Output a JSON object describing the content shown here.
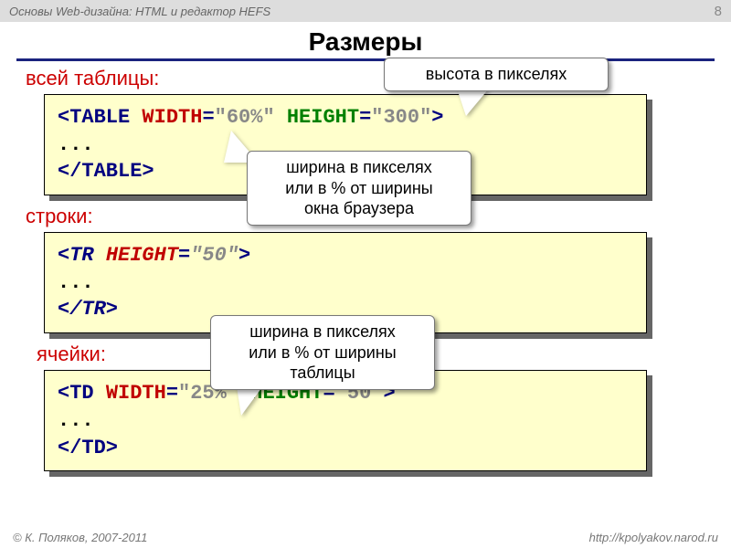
{
  "header": {
    "course": "Основы Web-дизайна: HTML и редактор HEFS",
    "page": "8"
  },
  "title": "Размеры",
  "labels": {
    "table": "всей таблицы:",
    "row": "строки:",
    "cell": "ячейки:"
  },
  "code": {
    "table": {
      "open_pre": "<TABLE ",
      "w": "WIDTH",
      "eq": "=",
      "wval": "\"60%\"",
      "sp": " ",
      "h": "HEIGHT",
      "hval": "\"300\"",
      "open_post": ">",
      "dots": "...",
      "close": "</TABLE>"
    },
    "row": {
      "open_pre": "<TR ",
      "h": "HEIGHT",
      "eq": "=",
      "hval": "\"50\"",
      "open_post": ">",
      "dots": "...",
      "close": "</TR>"
    },
    "cell": {
      "open_pre": "<TD ",
      "w": "WIDTH",
      "eq": "=",
      "wval": "\"25%\"",
      "sp": " ",
      "h": "HEIGHT",
      "hval": "\"50\"",
      "open_post": ">",
      "dots": "...",
      "close": "</TD>"
    }
  },
  "callouts": {
    "height_px": "высота в пикселях",
    "width_browser": "ширина в пикселях\nили в % от ширины\nокна браузера",
    "width_table": "ширина в пикселях\nили в % от ширины\nтаблицы"
  },
  "footer": {
    "left": "© К. Поляков, 2007-2011",
    "right": "http://kpolyakov.narod.ru"
  }
}
